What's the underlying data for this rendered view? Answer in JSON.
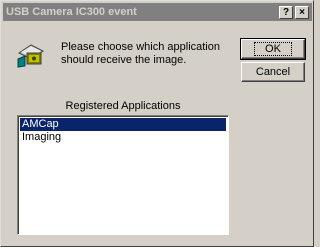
{
  "window": {
    "title": "USB Camera IC300 event",
    "help_label": "?",
    "close_label": "×"
  },
  "prompt": {
    "text": "Please choose which application should receive the image."
  },
  "buttons": {
    "ok_label": "OK",
    "cancel_label": "Cancel"
  },
  "applications": {
    "heading": "Registered Applications",
    "items": [
      {
        "label": "AMCap",
        "selected": true
      },
      {
        "label": "Imaging",
        "selected": false
      }
    ]
  },
  "icons": {
    "app": "camera-event-icon"
  },
  "colors": {
    "title_bar_inactive": "#808080",
    "selection": "#0a246a",
    "face": "#d4d0c8"
  }
}
